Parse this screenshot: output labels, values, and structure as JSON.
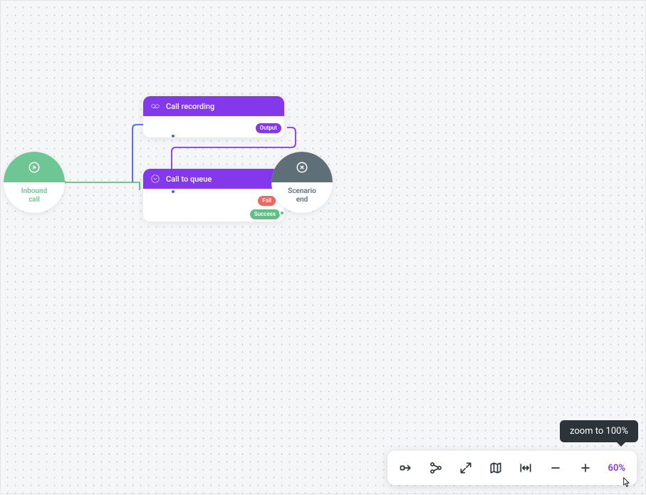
{
  "nodes": {
    "start": {
      "label": "Inbound\ncall"
    },
    "recording": {
      "title": "Call recording",
      "outputs": {
        "output": "Output"
      }
    },
    "queue": {
      "title": "Call to queue",
      "outputs": {
        "fail": "Fail",
        "success": "Success"
      }
    },
    "end": {
      "label": "Scenario\nend"
    }
  },
  "toolbar": {
    "zoom_level": "60%",
    "tooltip": "zoom to 100%"
  },
  "colors": {
    "accent": "#8338ec",
    "success": "#5fbf85",
    "fail": "#ee6a5f",
    "start": "#6ec695",
    "end": "#5e6f78"
  }
}
